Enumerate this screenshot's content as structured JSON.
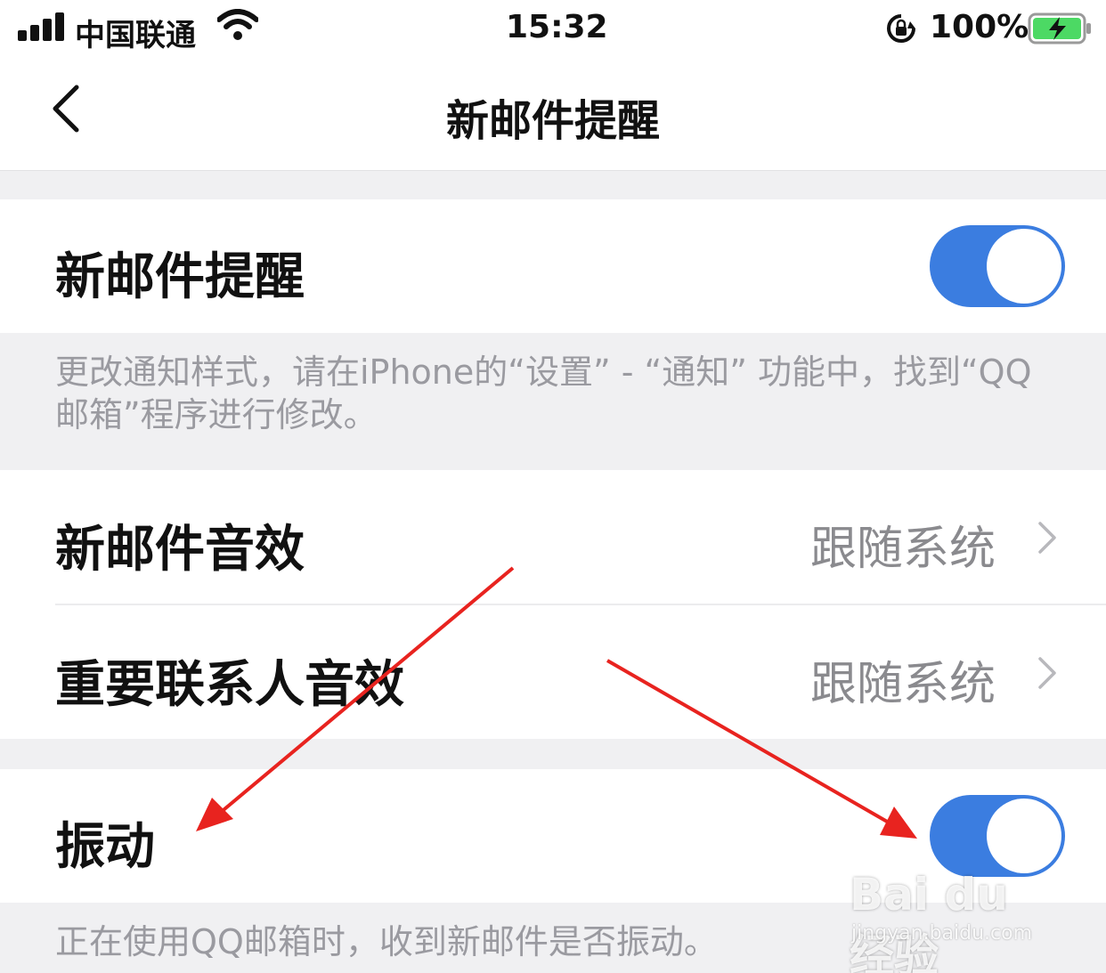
{
  "status_bar": {
    "carrier": "中国联通",
    "time": "15:32",
    "battery_percent": "100%",
    "battery_charging": true,
    "icons": [
      "signal-icon",
      "wifi-icon",
      "orientation-lock-icon",
      "battery-icon"
    ]
  },
  "nav": {
    "title": "新邮件提醒",
    "back_icon": "chevron-left-icon"
  },
  "settings": {
    "new_mail_alert": {
      "label": "新邮件提醒",
      "enabled": true
    },
    "alert_note": "更改通知样式，请在iPhone的“设置” - “通知” 功能中，找到“QQ邮箱”程序进行修改。",
    "new_mail_sound": {
      "label": "新邮件音效",
      "value": "跟随系统"
    },
    "important_contact_sound": {
      "label": "重要联系人音效",
      "value": "跟随系统"
    },
    "vibration": {
      "label": "振动",
      "enabled": true
    },
    "vibration_note": "正在使用QQ邮箱时，收到新邮件是否振动。"
  },
  "colors": {
    "toggle_on": "#3b7de0",
    "annotation_arrow": "#e8231f",
    "background": "#f0f0f2"
  },
  "watermark": {
    "brand": "Bai du 经验",
    "url": "jingyan.baidu.com"
  }
}
